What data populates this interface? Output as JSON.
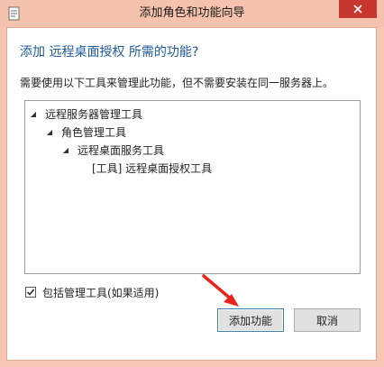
{
  "window": {
    "title": "添加角色和功能向导",
    "icon": "wizard-app-icon",
    "close_icon": "close-icon"
  },
  "dialog": {
    "heading": "添加 远程桌面授权 所需的功能?",
    "description": "需要使用以下工具来管理此功能，但不需要安装在同一服务器上。"
  },
  "tree": {
    "items": [
      {
        "label": "远程服务器管理工具",
        "level": 0,
        "expanded": true
      },
      {
        "label": "角色管理工具",
        "level": 1,
        "expanded": true
      },
      {
        "label": "远程桌面服务工具",
        "level": 2,
        "expanded": true
      },
      {
        "label": "[工具] 远程桌面授权工具",
        "level": 3,
        "expanded": false
      }
    ]
  },
  "options": {
    "include_tools_label": "包括管理工具(如果适用)",
    "include_tools_checked": true
  },
  "buttons": {
    "add_label": "添加功能",
    "cancel_label": "取消"
  },
  "colors": {
    "title_bar": "#f5c2ad",
    "close_button": "#c7372f",
    "heading": "#1e5a9c",
    "annotation_arrow": "#e8231c"
  }
}
